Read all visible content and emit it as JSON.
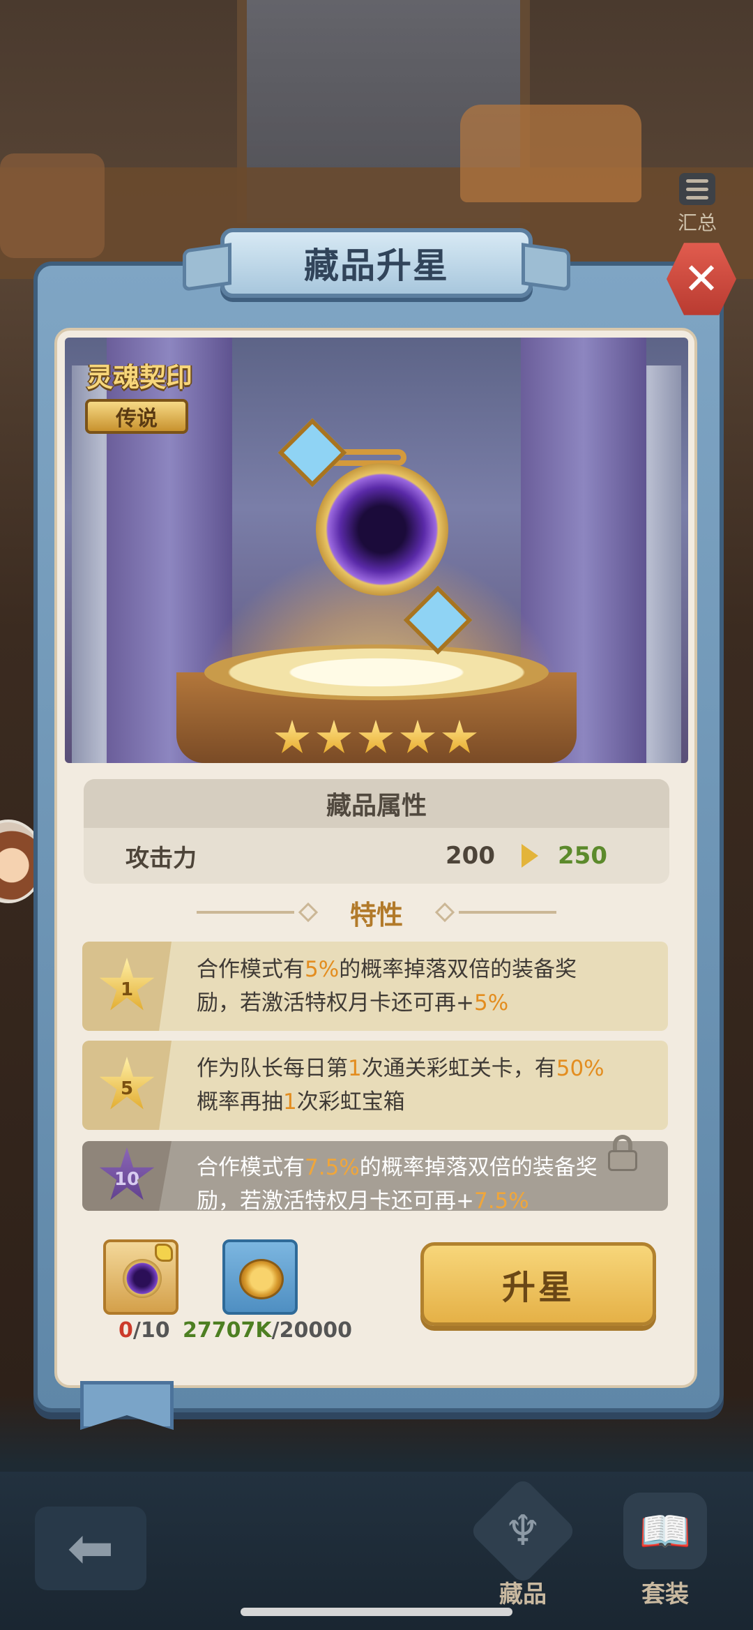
{
  "header": {
    "title": "藏品升星",
    "summary_label": "汇总",
    "close_icon": "close-icon"
  },
  "item": {
    "name": "灵魂契印",
    "rarity": "传说",
    "star_count": 5
  },
  "attributes": {
    "header": "藏品属性",
    "rows": [
      {
        "name": "攻击力",
        "current": "200",
        "next": "250"
      }
    ]
  },
  "traits": {
    "header": "特性",
    "items": [
      {
        "level": "1",
        "locked": false,
        "parts": [
          "合作模式有",
          "5%",
          "的概率掉落双倍的装备奖励，若激活特权月卡还可再+",
          "5%"
        ]
      },
      {
        "level": "5",
        "locked": false,
        "parts": [
          "作为队长每日第",
          "1",
          "次通关彩虹关卡，有",
          "50%",
          "概率再抽",
          "1",
          "次彩虹宝箱"
        ]
      },
      {
        "level": "10",
        "locked": true,
        "parts": [
          "合作模式有",
          "7.5%",
          "的概率掉落双倍的装备奖励，若激活特权月卡还可再+",
          "7.5%"
        ]
      }
    ]
  },
  "materials": {
    "fragment": {
      "owned": "0",
      "required": "/10"
    },
    "coin": {
      "owned": "27707K",
      "required": "/20000"
    }
  },
  "actions": {
    "upgrade_label": "升星"
  },
  "bottom_nav": {
    "back_icon": "back-arrow-icon",
    "items": [
      {
        "label": "藏品",
        "icon": "collection-icon"
      },
      {
        "label": "套装",
        "icon": "suit-book-icon"
      }
    ]
  },
  "colors": {
    "highlight": "#e38d1f",
    "attr_next": "#5c8a2c",
    "panel_blue": "#7fa5c4",
    "button_gold": "#e5b147"
  }
}
